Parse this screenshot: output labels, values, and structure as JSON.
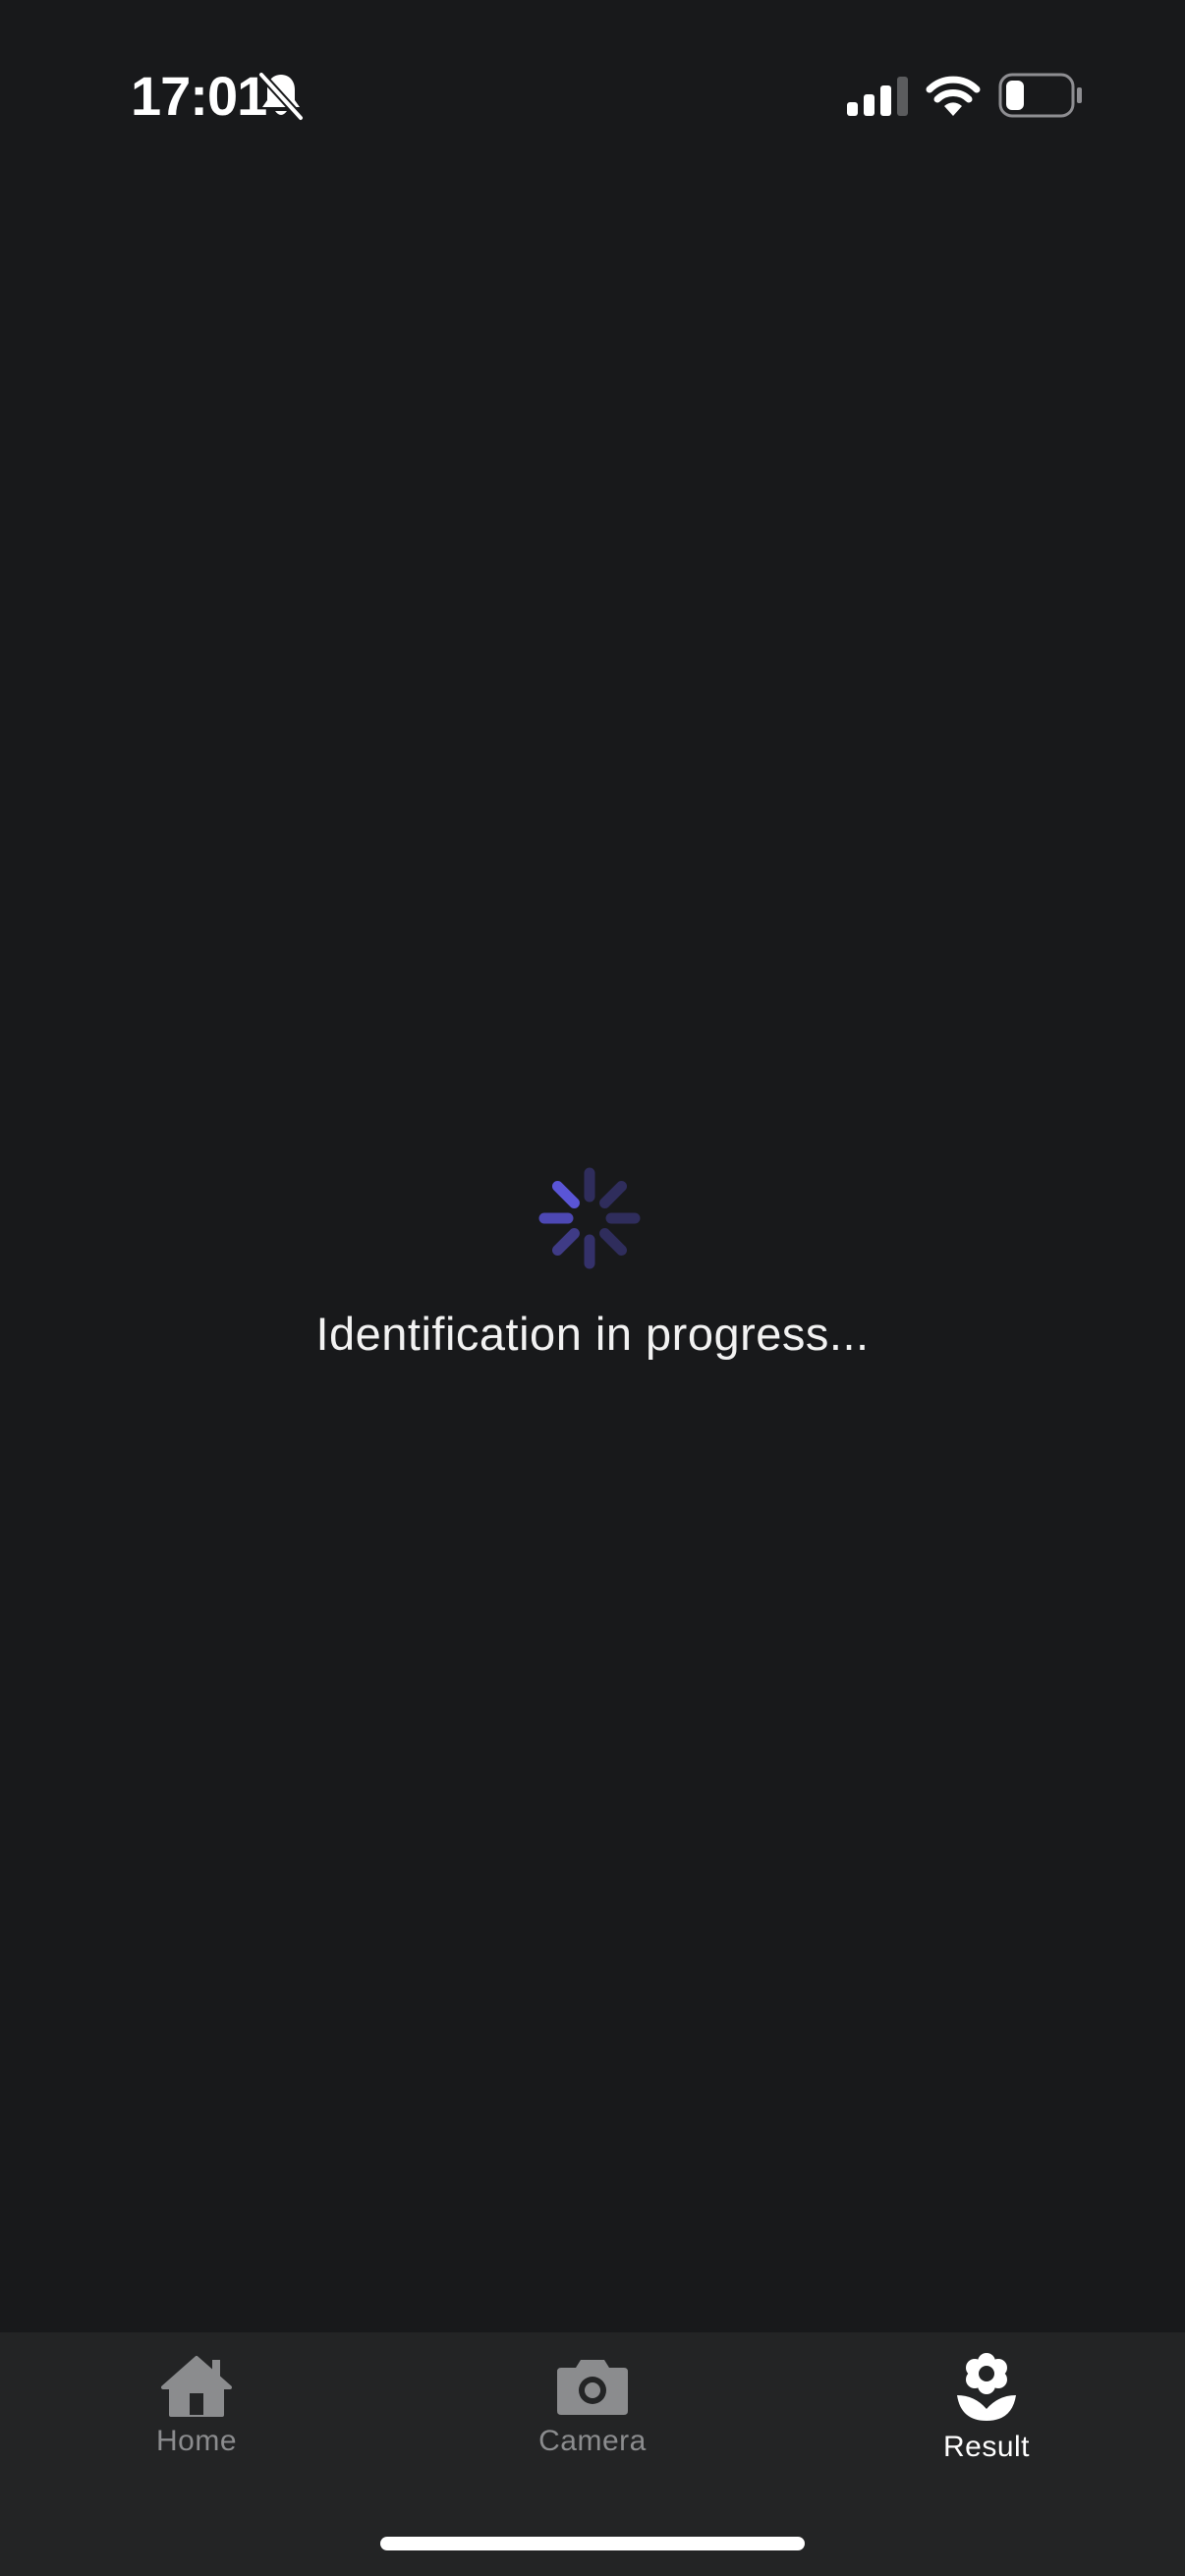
{
  "status_bar": {
    "time": "17:01",
    "icons": [
      "mute-bell-icon",
      "cellular-signal-icon",
      "wifi-icon",
      "battery-icon"
    ]
  },
  "loading": {
    "spinner_icon": "activity-spinner-icon",
    "message": "Identification in progress..."
  },
  "tab_bar": {
    "tabs": [
      {
        "label": "Home",
        "icon": "home-icon",
        "active": false
      },
      {
        "label": "Camera",
        "icon": "camera-icon",
        "active": false
      },
      {
        "label": "Result",
        "icon": "flower-icon",
        "active": true
      }
    ]
  },
  "colors": {
    "background": "#18191b",
    "tab_bar_background": "#232425",
    "spinner_accent": "#5a55d6",
    "inactive_tab": "#8b8c8e",
    "active_tab": "#ffffff"
  }
}
